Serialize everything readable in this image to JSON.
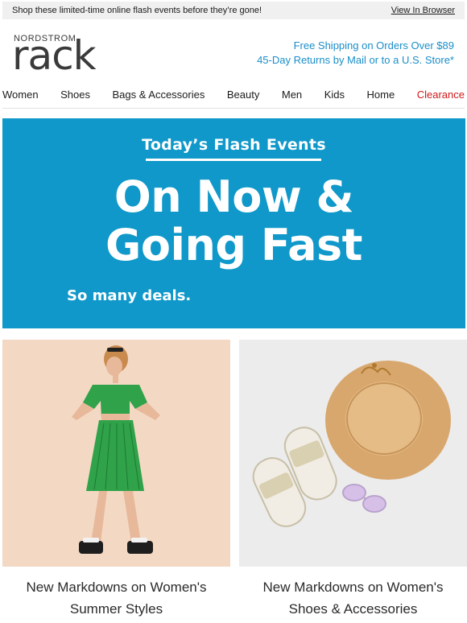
{
  "preheader": {
    "text": "Shop these limited-time online flash events before they’re gone!",
    "view_in_browser": "View In Browser"
  },
  "header": {
    "logo_small": "NORDSTROM",
    "logo_big": "rack",
    "promo_line1": "Free Shipping on Orders Over $89",
    "promo_line2": "45-Day Returns by Mail or to a U.S. Store*"
  },
  "nav": {
    "items": [
      "Women",
      "Shoes",
      "Bags & Accessories",
      "Beauty",
      "Men",
      "Kids",
      "Home",
      "Clearance"
    ]
  },
  "hero": {
    "eyebrow": "Today’s Flash Events",
    "headline_line1": "On Now &",
    "headline_line2": "Going Fast",
    "sub": "So many deals."
  },
  "tiles": [
    {
      "caption_line1": "New Markdowns on Women's",
      "caption_line2": "Summer Styles"
    },
    {
      "caption_line1": "New Markdowns on Women's",
      "caption_line2": "Shoes & Accessories"
    }
  ],
  "colors": {
    "accent_blue": "#1a8ec9",
    "hero_blue": "#0f98c9",
    "clearance_red": "#d0181a"
  }
}
